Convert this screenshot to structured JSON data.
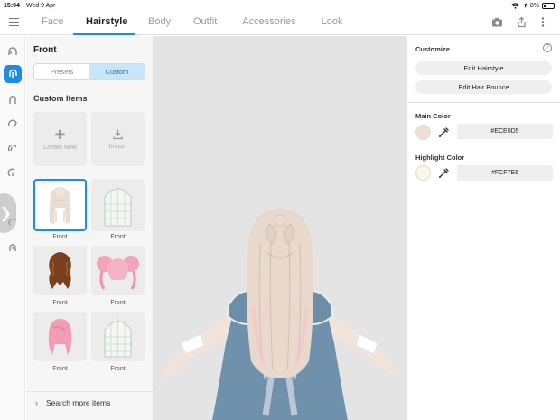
{
  "status_bar": {
    "time": "15:04",
    "date": "Wed 9 Apr",
    "battery": "8%",
    "wifi_icon": "wifi-icon",
    "battery_icon": "battery-icon"
  },
  "top_bar": {
    "menu_icon": "menu-icon",
    "tabs": [
      {
        "label": "Face",
        "active": false
      },
      {
        "label": "Hairstyle",
        "active": true
      },
      {
        "label": "Body",
        "active": false
      },
      {
        "label": "Outfit",
        "active": false
      },
      {
        "label": "Accessories",
        "active": false
      },
      {
        "label": "Look",
        "active": false
      }
    ],
    "actions": [
      "camera-icon",
      "share-icon",
      "more-icon"
    ],
    "accent_color": "#1C8DE0"
  },
  "left_rail": {
    "categories": [
      "hair-front-icon",
      "hair-full-icon",
      "hair-back-icon",
      "hair-side-icon",
      "hair-bangs-icon",
      "hair-ahoge-icon",
      "hair-extra-icon",
      "hair-other-icon"
    ],
    "active_index": 1,
    "expand_icon": "chevron-right-icon"
  },
  "items_panel": {
    "title": "Front",
    "segments": [
      {
        "label": "Presets",
        "active": false
      },
      {
        "label": "Custom",
        "active": true
      }
    ],
    "section_label": "Custom Items",
    "actions": [
      {
        "label": "Create New",
        "icon": "plus-icon"
      },
      {
        "label": "Import",
        "icon": "download-icon"
      }
    ],
    "items": [
      {
        "label": "Front",
        "thumb": "long-blonde-hair",
        "selected": true
      },
      {
        "label": "Front",
        "thumb": "wireframe-template",
        "selected": false
      },
      {
        "label": "Front",
        "thumb": "brown-wavy-hair",
        "selected": false
      },
      {
        "label": "Front",
        "thumb": "pink-twin-buns",
        "selected": false
      },
      {
        "label": "Front",
        "thumb": "pink-bob-hair",
        "selected": false
      },
      {
        "label": "Front",
        "thumb": "wireframe-template",
        "selected": false
      }
    ],
    "search_more": "Search more items"
  },
  "customize": {
    "title": "Customize",
    "help_icon": "help-icon",
    "edit_hairstyle": "Edit Hairstyle",
    "edit_hair_bounce": "Edit Hair Bounce",
    "main_color_label": "Main Color",
    "main_color_hex": "#ECE0D5",
    "main_color": "#ECE0D5",
    "highlight_color_label": "Highlight Color",
    "highlight_color_hex": "#FCF7E6",
    "highlight_color": "#FCF7E6",
    "picker_icon": "eyedropper-icon"
  }
}
